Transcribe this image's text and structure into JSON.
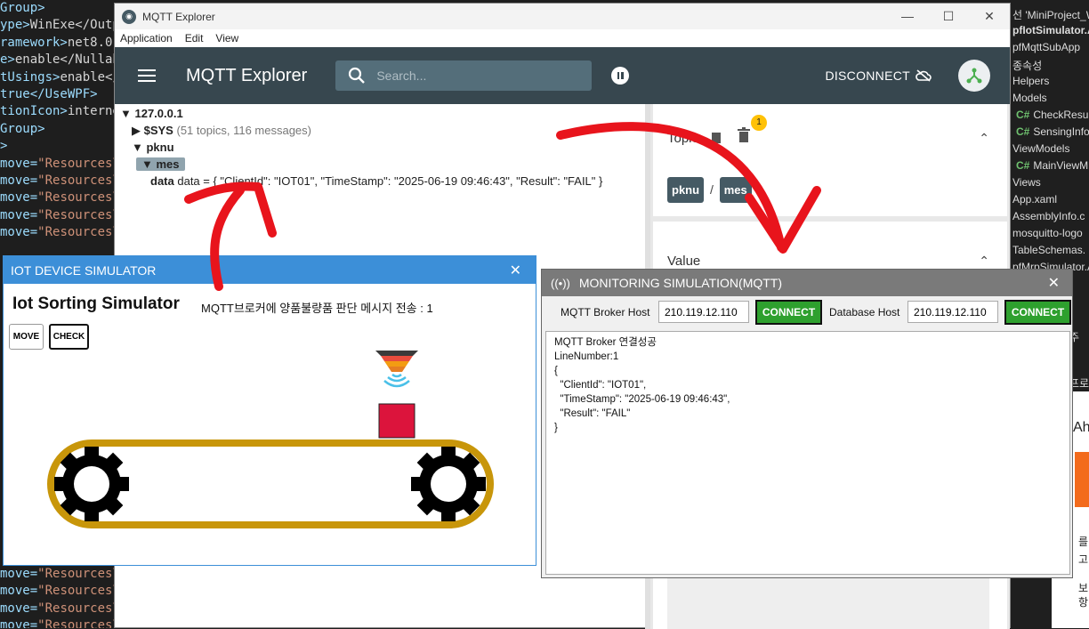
{
  "editor_left": {
    "lines": [
      {
        "a": "Group>",
        "b": ""
      },
      {
        "a": "ype>",
        "b": "WinExe</OutputT"
      },
      {
        "a": "ramework>",
        "b": "net8.0-w"
      },
      {
        "a": "e>",
        "b": "enable</Nullab"
      },
      {
        "a": "tUsings>",
        "b": "enable</I"
      },
      {
        "a": "true</UseWPF>",
        "b": ""
      },
      {
        "a": "tionIcon>",
        "b": "interne"
      },
      {
        "a": "Group>",
        "b": ""
      },
      {
        "a": "",
        "b": ""
      },
      {
        "a": ">",
        "b": ""
      },
      {
        "a": "move=",
        "b": "\"Resources\\a"
      },
      {
        "a": "move=",
        "b": "\"Resources\\a"
      },
      {
        "a": "move=",
        "b": "\"Resources\\a"
      },
      {
        "a": "move=",
        "b": "\"Resources\\a"
      },
      {
        "a": "move=",
        "b": "\"Resources\\b"
      }
    ],
    "bottom_lines": [
      {
        "a": "move=",
        "b": "\"Resources\\c"
      },
      {
        "a": "move=",
        "b": "\"Resources\\c"
      },
      {
        "a": "move=",
        "b": "\"Resources\\c"
      },
      {
        "a": "move=",
        "b": "\"Resources\\c"
      }
    ]
  },
  "solution_right": {
    "items": [
      {
        "text": "선 'MiniProject_W",
        "cs": false,
        "bold": false
      },
      {
        "text": "pfIotSimulator.A",
        "cs": false,
        "bold": true
      },
      {
        "text": "pfMqttSubApp",
        "cs": false,
        "bold": false
      },
      {
        "text": "종속성",
        "cs": false,
        "bold": false
      },
      {
        "text": "Helpers",
        "cs": false,
        "bold": false
      },
      {
        "text": "Models",
        "cs": false,
        "bold": false
      },
      {
        "text": "CheckResult",
        "cs": true,
        "bold": false
      },
      {
        "text": "SensingInfo",
        "cs": true,
        "bold": false
      },
      {
        "text": "ViewModels",
        "cs": false,
        "bold": false
      },
      {
        "text": "MainViewM",
        "cs": true,
        "bold": false
      },
      {
        "text": "Views",
        "cs": false,
        "bold": false
      },
      {
        "text": "App.xaml",
        "cs": false,
        "bold": false
      },
      {
        "text": "AssemblyInfo.c",
        "cs": false,
        "bold": false
      },
      {
        "text": "mosquitto-logo",
        "cs": false,
        "bold": false
      },
      {
        "text": "TableSchemas.",
        "cs": false,
        "bold": false
      },
      {
        "text": "pfMrpSimulator.A",
        "cs": false,
        "bold": false
      }
    ],
    "lower": [
      "주",
      "프로",
      "Ah",
      "를",
      "고",
      "보",
      "항"
    ]
  },
  "mqtt_explorer": {
    "window_title": "MQTT Explorer",
    "menu": [
      "Application",
      "Edit",
      "View"
    ],
    "app_title": "MQTT Explorer",
    "search_placeholder": "Search...",
    "disconnect_label": "DISCONNECT",
    "tree": {
      "host": "127.0.0.1",
      "sys_label": "$SYS",
      "sys_count": "(51 topics, 116 messages)",
      "pknu": "pknu",
      "mes": "mes",
      "data_line": "data = { \"ClientId\": \"IOT01\", \"TimeStamp\": \"2025-06-19 09:46:43\", \"Result\": \"FAIL\" }"
    },
    "topic_label": "Topic",
    "topic_badge": "1",
    "topic_path": [
      "pknu",
      "mes"
    ],
    "topic_sep": "/",
    "value_label": "Value"
  },
  "iot_sim": {
    "title": "IOT DEVICE SIMULATOR",
    "heading": "Iot Sorting Simulator",
    "message": "MQTT브로커에 양품불량품 판단 메시지 전송 : 1",
    "move_label": "MOVE",
    "check_label": "CHECK",
    "product_color": "#dc143c",
    "belt_color": "#c8960a"
  },
  "monitoring": {
    "title": "MONITORING SIMULATION(MQTT)",
    "broker_label": "MQTT Broker Host",
    "broker_value": "210.119.12.110",
    "connect_label": "CONNECT",
    "db_label": "Database Host",
    "db_value": "210.119.12.110",
    "log": "MQTT Broker 연결성공\nLineNumber:1\n{\n  \"ClientId\": \"IOT01\",\n  \"TimeStamp\": \"2025-06-19 09:46:43\",\n  \"Result\": \"FAIL\"\n}"
  },
  "colors": {
    "appbar": "#37474f",
    "iot_accent": "#3c8fd8",
    "connect_green": "#2ea02e",
    "arrow_red": "#e8141c"
  }
}
